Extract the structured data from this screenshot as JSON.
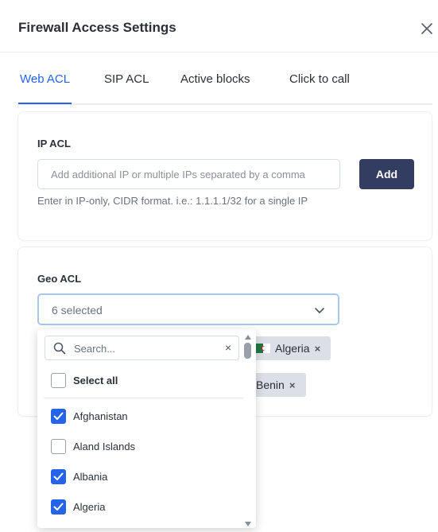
{
  "modal": {
    "title": "Firewall Access Settings"
  },
  "tabs": [
    {
      "label": "Web ACL",
      "active": true
    },
    {
      "label": "SIP ACL",
      "active": false
    },
    {
      "label": "Active blocks",
      "active": false
    },
    {
      "label": "Click to call",
      "active": false
    }
  ],
  "ip_acl": {
    "label": "IP ACL",
    "input_value": "",
    "placeholder": "Add additional IP or multiple IPs separated by a comma",
    "add_label": "Add",
    "help": "Enter in IP-only, CIDR format. i.e.: 1.1.1.1/32 for a single IP"
  },
  "geo_acl": {
    "label": "Geo ACL",
    "selected_text": "6 selected",
    "chips": [
      {
        "label": "Algeria",
        "remove": "×",
        "flag": "algeria-flag-icon"
      },
      {
        "label": "Benin",
        "remove": "×"
      }
    ]
  },
  "dropdown": {
    "search_placeholder": "Search...",
    "clear": "×",
    "select_all": {
      "label": "Select all",
      "checked": false
    },
    "options": [
      {
        "label": "Afghanistan",
        "checked": true
      },
      {
        "label": "Aland Islands",
        "checked": false
      },
      {
        "label": "Albania",
        "checked": true
      },
      {
        "label": "Algeria",
        "checked": true
      }
    ]
  },
  "colors": {
    "accent": "#2563eb",
    "add_button": "#333d62",
    "chip": "#dcdfe5",
    "focus_border": "#a7c7f0"
  }
}
